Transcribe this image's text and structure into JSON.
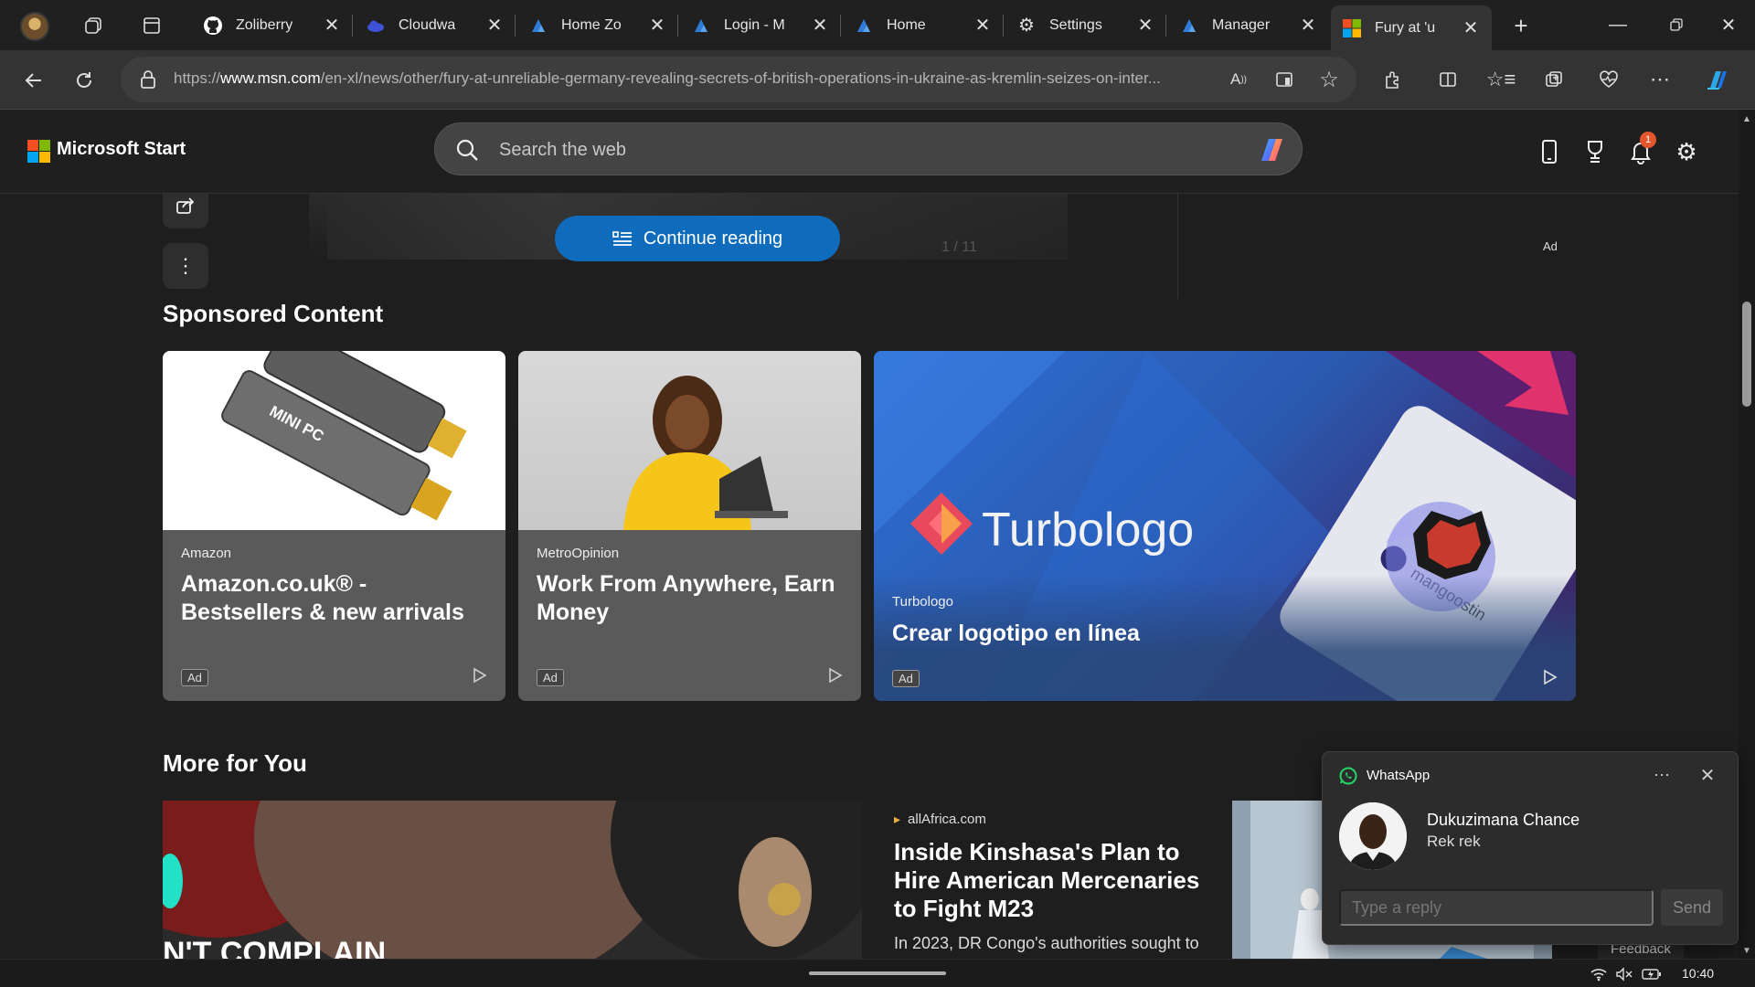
{
  "browser": {
    "tabs": [
      {
        "label": "Zoliberry",
        "icon": "github-icon"
      },
      {
        "label": "Cloudwa",
        "icon": "cloud-icon"
      },
      {
        "label": "Home Zo",
        "icon": "app-icon"
      },
      {
        "label": "Login - M",
        "icon": "app-icon"
      },
      {
        "label": "Home",
        "icon": "app-icon"
      },
      {
        "label": "Settings",
        "icon": "gear-icon"
      },
      {
        "label": "Manager",
        "icon": "app-icon"
      },
      {
        "label": "Fury at 'u",
        "icon": "msn-icon",
        "active": true
      }
    ],
    "new_tab": "+",
    "url_prefix": "https://",
    "url_domain": "www.msn.com",
    "url_path": "/en-xl/news/other/fury-at-unreliable-germany-revealing-secrets-of-british-operations-in-ukraine-as-kremlin-seizes-on-inter..."
  },
  "msn": {
    "brand": "Microsoft Start",
    "search_placeholder": "Search the web",
    "notification_count": "1"
  },
  "article": {
    "continue_label": "Continue reading",
    "counter": "1 / 11",
    "ad_label": "Ad"
  },
  "sponsored": {
    "title": "Sponsored Content",
    "cards": [
      {
        "source": "Amazon",
        "title": "Amazon.co.uk® - Bestsellers & new arrivals",
        "ad": "Ad",
        "image_text": "MINI PC"
      },
      {
        "source": "MetroOpinion",
        "title": "Work From Anywhere, Earn Money",
        "ad": "Ad"
      },
      {
        "source": "Turbologo",
        "title": "Crear logotipo en línea",
        "ad": "Ad",
        "image_text": "Turbologo",
        "card_text": "mangoostin"
      }
    ]
  },
  "more": {
    "title": "More for You",
    "big_image_text": "N'T COMPLAIN",
    "story": {
      "source": "allAfrica.com",
      "title": "Inside Kinshasa's Plan to Hire American Mercenaries to Fight M23",
      "desc": "In 2023, DR Congo's authorities sought to"
    },
    "feedback": "Feedback"
  },
  "toast": {
    "app": "WhatsApp",
    "sender": "Dukuzimana Chance",
    "message": "Rek rek",
    "reply_placeholder": "Type a reply",
    "send": "Send"
  },
  "taskbar": {
    "time": "10:40"
  },
  "colors": {
    "accent": "#0f6cbd",
    "whatsapp": "#25d366",
    "badge": "#e4572e"
  }
}
